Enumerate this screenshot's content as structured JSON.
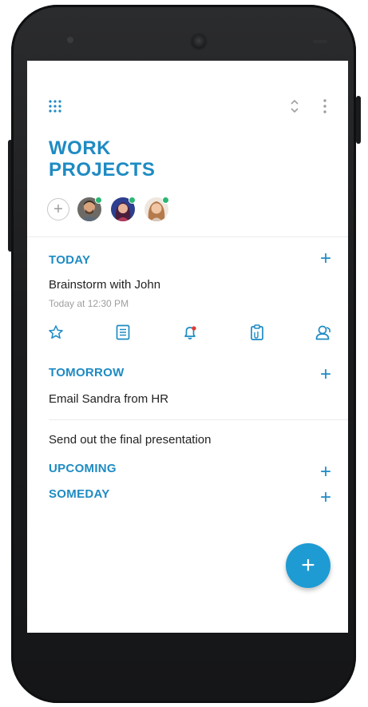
{
  "project": {
    "title_line1": "WORK",
    "title_line2": "PROJECTS"
  },
  "toolbar": {
    "menu_icon": "apps-grid-icon",
    "sort_icon": "unfold-icon",
    "more_icon": "more-vertical-icon"
  },
  "members": {
    "add_icon": "plus-icon",
    "add_label": "+",
    "online_color": "#2bb673",
    "people": [
      {
        "name": "member-1"
      },
      {
        "name": "member-2"
      },
      {
        "name": "member-3"
      }
    ]
  },
  "sections": {
    "today": {
      "heading": "TODAY",
      "add": "+",
      "task": {
        "title": "Brainstorm with John",
        "subtitle": "Today at 12:30 PM"
      },
      "actions": [
        "star-icon",
        "note-icon",
        "reminder-icon",
        "clipboard-icon",
        "assign-icon"
      ]
    },
    "tomorrow": {
      "heading": "TOMORROW",
      "add": "+",
      "tasks": [
        "Email Sandra from HR",
        "Send out the final presentation"
      ]
    },
    "upcoming": {
      "heading": "UPCOMING",
      "add": "+"
    },
    "someday": {
      "heading": "SOMEDAY",
      "add": "+"
    }
  },
  "fab": {
    "label": "+"
  },
  "colors": {
    "accent": "#1e8bc3",
    "fab": "#1e9bd3",
    "reminder_dot": "#e53935"
  }
}
